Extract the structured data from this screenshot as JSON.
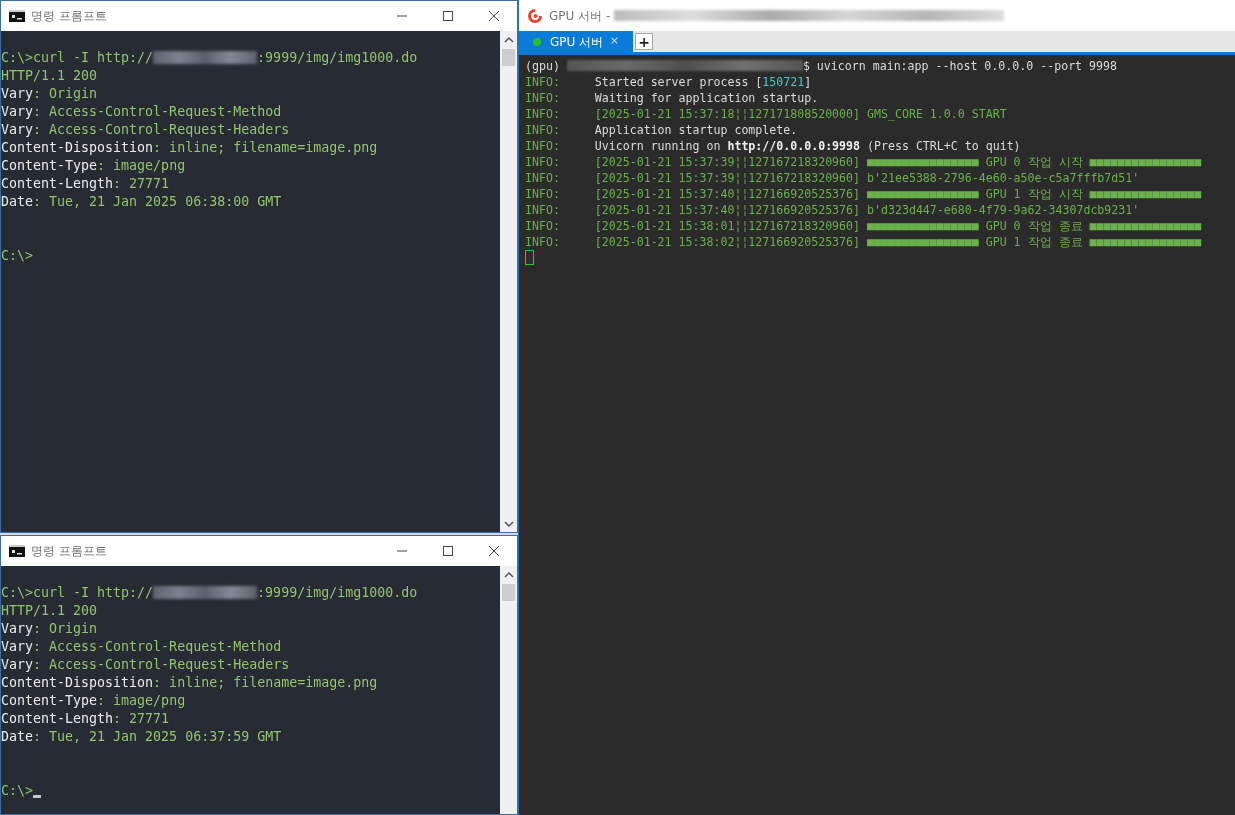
{
  "cmd_windows": [
    {
      "title": "명령 프롬프트",
      "cursor": false,
      "lines": [
        {
          "spaced": false,
          "segments": [
            {
              "kind": "value",
              "text": "C:\\>curl -I http://"
            },
            {
              "kind": "redacted"
            },
            {
              "kind": "value",
              "text": ":9999/img/img1000.do"
            }
          ]
        },
        {
          "spaced": false,
          "segments": [
            {
              "kind": "value",
              "text": "HTTP/1.1 200"
            }
          ]
        },
        {
          "spaced": false,
          "segments": [
            {
              "kind": "key",
              "text": "Vary"
            },
            {
              "kind": "value",
              "text": ": Origin"
            }
          ]
        },
        {
          "spaced": false,
          "segments": [
            {
              "kind": "key",
              "text": "Vary"
            },
            {
              "kind": "value",
              "text": ": Access-Control-Request-Method"
            }
          ]
        },
        {
          "spaced": false,
          "segments": [
            {
              "kind": "key",
              "text": "Vary"
            },
            {
              "kind": "value",
              "text": ": Access-Control-Request-Headers"
            }
          ]
        },
        {
          "spaced": false,
          "segments": [
            {
              "kind": "key",
              "text": "Content-Disposition"
            },
            {
              "kind": "value",
              "text": ": inline; filename=image.png"
            }
          ]
        },
        {
          "spaced": false,
          "segments": [
            {
              "kind": "key",
              "text": "Content-Type"
            },
            {
              "kind": "value",
              "text": ": image/png"
            }
          ]
        },
        {
          "spaced": false,
          "segments": [
            {
              "kind": "key",
              "text": "Content-Length"
            },
            {
              "kind": "value",
              "text": ": 27771"
            }
          ]
        },
        {
          "spaced": false,
          "segments": [
            {
              "kind": "key",
              "text": "Date"
            },
            {
              "kind": "value",
              "text": ": Tue, 21 Jan 2025 06:38:00 GMT"
            }
          ]
        },
        {
          "spaced": true,
          "segments": [
            {
              "kind": "value",
              "text": "C:\\>"
            }
          ]
        }
      ]
    },
    {
      "title": "명령 프롬프트",
      "cursor": true,
      "lines": [
        {
          "spaced": false,
          "segments": [
            {
              "kind": "value",
              "text": "C:\\>curl -I http://"
            },
            {
              "kind": "redacted"
            },
            {
              "kind": "value",
              "text": ":9999/img/img1000.do"
            }
          ]
        },
        {
          "spaced": false,
          "segments": [
            {
              "kind": "value",
              "text": "HTTP/1.1 200"
            }
          ]
        },
        {
          "spaced": false,
          "segments": [
            {
              "kind": "key",
              "text": "Vary"
            },
            {
              "kind": "value",
              "text": ": Origin"
            }
          ]
        },
        {
          "spaced": false,
          "segments": [
            {
              "kind": "key",
              "text": "Vary"
            },
            {
              "kind": "value",
              "text": ": Access-Control-Request-Method"
            }
          ]
        },
        {
          "spaced": false,
          "segments": [
            {
              "kind": "key",
              "text": "Vary"
            },
            {
              "kind": "value",
              "text": ": Access-Control-Request-Headers"
            }
          ]
        },
        {
          "spaced": false,
          "segments": [
            {
              "kind": "key",
              "text": "Content-Disposition"
            },
            {
              "kind": "value",
              "text": ": inline; filename=image.png"
            }
          ]
        },
        {
          "spaced": false,
          "segments": [
            {
              "kind": "key",
              "text": "Content-Type"
            },
            {
              "kind": "value",
              "text": ": image/png"
            }
          ]
        },
        {
          "spaced": false,
          "segments": [
            {
              "kind": "key",
              "text": "Content-Length"
            },
            {
              "kind": "value",
              "text": ": 27771"
            }
          ]
        },
        {
          "spaced": false,
          "segments": [
            {
              "kind": "key",
              "text": "Date"
            },
            {
              "kind": "value",
              "text": ": Tue, 21 Jan 2025 06:37:59 GMT"
            }
          ]
        },
        {
          "spaced": true,
          "segments": [
            {
              "kind": "value",
              "text": "C:\\>"
            }
          ]
        }
      ]
    }
  ],
  "terminal": {
    "title": "GPU 서버 - ",
    "tabs": [
      {
        "label": "GPU 서버",
        "close": "×",
        "selected": true
      }
    ],
    "new_tab": "+",
    "lines": [
      {
        "label": "(gpu) ",
        "segments": [
          {
            "kind": "redacted"
          },
          {
            "kind": "msg",
            "text": "$ uvicorn main:app --host 0.0.0.0 --port 9998"
          }
        ]
      },
      {
        "label": "INFO:",
        "segments": [
          {
            "kind": "msg",
            "text": "Started server process ["
          },
          {
            "kind": "pid",
            "text": "150721"
          },
          {
            "kind": "msg",
            "text": "]"
          }
        ]
      },
      {
        "label": "INFO:",
        "segments": [
          {
            "kind": "msg",
            "text": "Waiting for application startup."
          }
        ]
      },
      {
        "label": "INFO:",
        "segments": [
          {
            "kind": "log",
            "text": "[2025-01-21 15:37:18¦¦127171808520000] GMS_CORE 1.0.0 START"
          }
        ]
      },
      {
        "label": "INFO:",
        "segments": [
          {
            "kind": "msg",
            "text": "Application startup complete."
          }
        ]
      },
      {
        "label": "INFO:",
        "segments": [
          {
            "kind": "msg",
            "text": "Uvicorn running on "
          },
          {
            "kind": "url",
            "text": "http://0.0.0.0:9998"
          },
          {
            "kind": "msg",
            "text": " (Press CTRL+C to quit)"
          }
        ]
      },
      {
        "label": "INFO:",
        "segments": [
          {
            "kind": "log",
            "text": "[2025-01-21 15:37:39¦¦127167218320960] ■■■■■■■■■■■■■■■■ GPU 0 작업 시작 ■■■■■■■■■■■■■■■■"
          }
        ]
      },
      {
        "label": "INFO:",
        "segments": [
          {
            "kind": "log",
            "text": "[2025-01-21 15:37:39¦¦127167218320960] b'21ee5388-2796-4e60-a50e-c5a7fffb7d51'"
          }
        ]
      },
      {
        "label": "INFO:",
        "segments": [
          {
            "kind": "log",
            "text": "[2025-01-21 15:37:40¦¦127166920525376] ■■■■■■■■■■■■■■■■ GPU 1 작업 시작 ■■■■■■■■■■■■■■■■"
          }
        ]
      },
      {
        "label": "INFO:",
        "segments": [
          {
            "kind": "log",
            "text": "[2025-01-21 15:37:40¦¦127166920525376] b'd323d447-e680-4f79-9a62-34307dcb9231'"
          }
        ]
      },
      {
        "label": "INFO:",
        "segments": [
          {
            "kind": "log",
            "text": "[2025-01-21 15:38:01¦¦127167218320960] ■■■■■■■■■■■■■■■■ GPU 0 작업 종료 ■■■■■■■■■■■■■■■■"
          }
        ]
      },
      {
        "label": "INFO:",
        "segments": [
          {
            "kind": "log",
            "text": "[2025-01-21 15:38:02¦¦127166920525376] ■■■■■■■■■■■■■■■■ GPU 1 작업 종료 ■■■■■■■■■■■■■■■■"
          }
        ]
      }
    ],
    "cursor": true
  }
}
